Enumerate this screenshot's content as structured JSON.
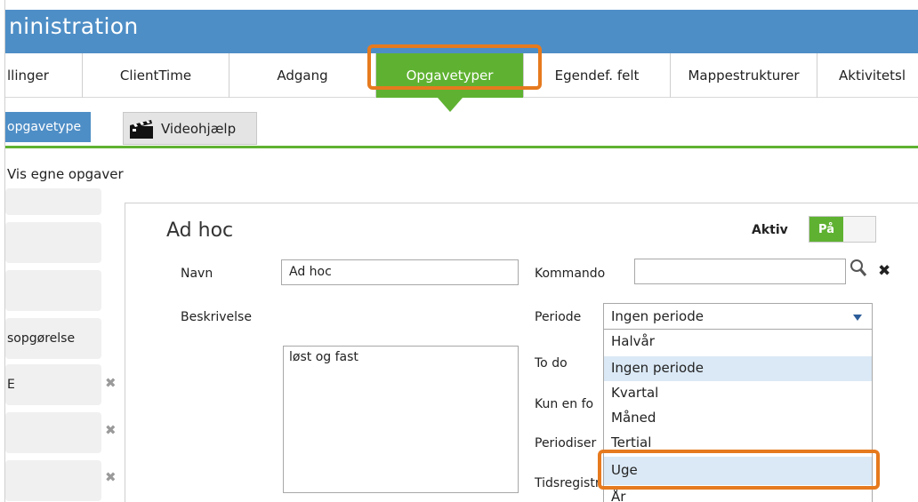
{
  "window": {
    "title": "ninistration"
  },
  "tabs": [
    {
      "label": "llinger"
    },
    {
      "label": "ClientTime"
    },
    {
      "label": "Adgang"
    },
    {
      "label": "Opgavetyper",
      "active": true
    },
    {
      "label": "Egendef. felt"
    },
    {
      "label": "Mappestrukturer"
    },
    {
      "label": "Aktivitetsl"
    }
  ],
  "toolbar": {
    "new_label": "opgavetype",
    "video_label": "Videohjælp"
  },
  "filters": {
    "show_own_label": "Vis egne opgaver"
  },
  "left_list": [
    {
      "label": ""
    },
    {
      "label": ""
    },
    {
      "label": ""
    },
    {
      "label": "sopgørelse"
    },
    {
      "label": "E"
    },
    {
      "label": ""
    },
    {
      "label": ""
    }
  ],
  "detail": {
    "title": "Ad hoc",
    "active_label": "Aktiv",
    "active_toggle": "På",
    "name_label": "Navn",
    "name_value": "Ad hoc",
    "description_label": "Beskrivelse",
    "description_value": "løst og fast",
    "command_label": "Kommando",
    "command_value": "",
    "period_label": "Periode",
    "period_value": "Ingen periode",
    "todo_label": "To do",
    "only_one_label": "Kun en fo",
    "periodize_label": "Periodiser",
    "time_reg_label": "Tidsregistr"
  },
  "period_options": [
    {
      "label": "Halvår"
    },
    {
      "label": "Ingen periode",
      "selected": true
    },
    {
      "label": "Kvartal"
    },
    {
      "label": "Måned"
    },
    {
      "label": "Tertial"
    },
    {
      "label": "Uge",
      "hovered": true
    },
    {
      "label": "År"
    }
  ],
  "colors": {
    "titlebar": "#4e8ec6",
    "accent_green": "#5fb231",
    "highlight_orange": "#e67a1e",
    "selected_option": "#dbe9f6"
  }
}
